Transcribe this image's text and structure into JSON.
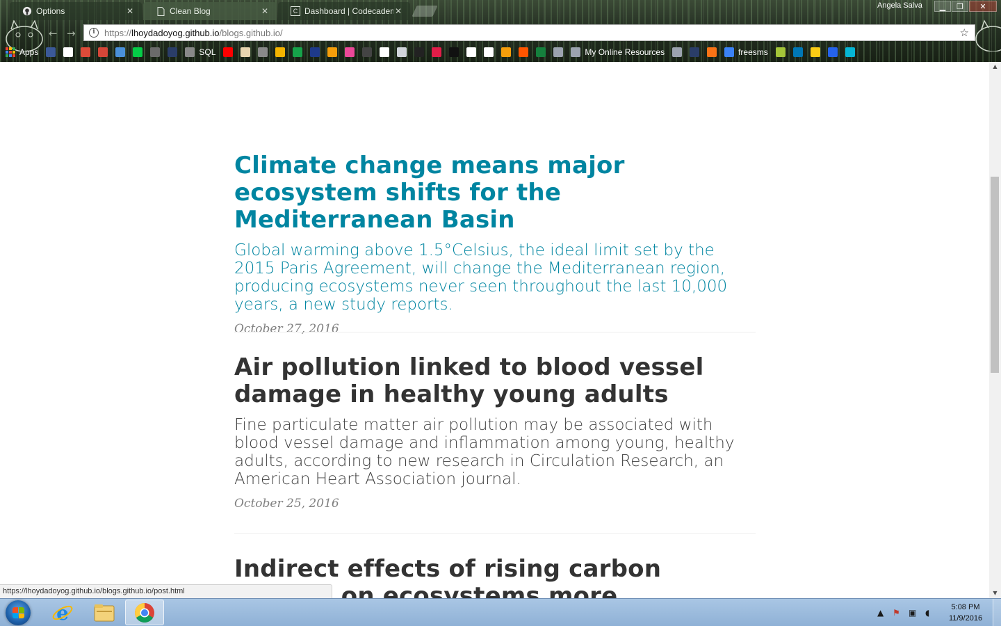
{
  "browser": {
    "tabs": [
      {
        "label": "Options",
        "icon": "github-icon",
        "active": false
      },
      {
        "label": "Clean Blog",
        "icon": "page-icon",
        "active": true
      },
      {
        "label": "Dashboard | Codecadem",
        "icon": "codecademy-icon",
        "active": false
      }
    ],
    "user": "Angela Salva",
    "address": {
      "scheme": "https://",
      "host": "lhoydadoyog.github.io",
      "path": "/blogs.github.io/"
    },
    "bookmarks": [
      {
        "label": "Apps",
        "icon": "apps-grid-icon"
      },
      {
        "label": "",
        "icon": "facebook-icon",
        "color": "#3b5998"
      },
      {
        "label": "",
        "icon": "google-icon",
        "color": "#ffffff"
      },
      {
        "label": "",
        "icon": "google-plus-icon",
        "color": "#dd4b39"
      },
      {
        "label": "",
        "icon": "gmail-icon",
        "color": "#d44638"
      },
      {
        "label": "",
        "icon": "shield-icon",
        "color": "#4a90d9"
      },
      {
        "label": "",
        "icon": "deviantart-icon",
        "color": "#05cc47"
      },
      {
        "label": "",
        "icon": "page-icon",
        "color": "#6b6b6b"
      },
      {
        "label": "",
        "icon": "bookmark-icon",
        "color": "#2a3d68"
      },
      {
        "label": "SQL",
        "icon": "sql-icon"
      },
      {
        "label": "",
        "icon": "youtube-icon",
        "color": "#ff0000"
      },
      {
        "label": "",
        "icon": "owl-icon",
        "color": "#e8d5b0"
      },
      {
        "label": "",
        "icon": "grid-icon",
        "color": "#8a8a8a"
      },
      {
        "label": "",
        "icon": "palette-icon",
        "color": "#f4b400"
      },
      {
        "label": "",
        "icon": "tv-icon",
        "color": "#16a34a"
      },
      {
        "label": "",
        "icon": "star-circle-icon",
        "color": "#1e3a8a"
      },
      {
        "label": "",
        "icon": "film-icon",
        "color": "#f59e0b"
      },
      {
        "label": "",
        "icon": "k-icon",
        "color": "#ec4899"
      },
      {
        "label": "",
        "icon": "cube-icon",
        "color": "#444444"
      },
      {
        "label": "",
        "icon": "reddit-icon",
        "color": "#ffffff"
      },
      {
        "label": "",
        "icon": "fork-icon",
        "color": "#d1d5db"
      },
      {
        "label": "",
        "icon": "alien-icon",
        "color": "#222222"
      },
      {
        "label": "",
        "icon": "m-icon",
        "color": "#e11d48"
      },
      {
        "label": "",
        "icon": "bug-icon",
        "color": "#111111"
      },
      {
        "label": "",
        "icon": "a-icon",
        "color": "#ffffff"
      },
      {
        "label": "",
        "icon": "spiral-icon",
        "color": "#ffffff"
      },
      {
        "label": "",
        "icon": "w-icon",
        "color": "#f59e0b"
      },
      {
        "label": "",
        "icon": "soundcloud-icon",
        "color": "#ff5500"
      },
      {
        "label": "",
        "icon": "book-icon",
        "color": "#15803d"
      },
      {
        "label": "",
        "icon": "robot-icon",
        "color": "#9ca3af"
      },
      {
        "label": "My Online Resources",
        "icon": "robot-icon",
        "color": "#9ca3af"
      },
      {
        "label": "",
        "icon": "robot-icon",
        "color": "#9ca3af"
      },
      {
        "label": "",
        "icon": "bookmark-icon",
        "color": "#2a3d68"
      },
      {
        "label": "",
        "icon": "orange-box-icon",
        "color": "#f97316"
      },
      {
        "label": "freesms",
        "icon": "phone-icon",
        "color": "#3b82f6"
      },
      {
        "label": "",
        "icon": "android-icon",
        "color": "#a4c639"
      },
      {
        "label": "",
        "icon": "linkedin-icon",
        "color": "#0077b5"
      },
      {
        "label": "",
        "icon": "question-box-icon",
        "color": "#facc15"
      },
      {
        "label": "",
        "icon": "target-icon",
        "color": "#2563eb"
      },
      {
        "label": "",
        "icon": "u-icon",
        "color": "#06b6d4"
      }
    ],
    "status_url": "https://lhoydadoyog.github.io/blogs.github.io/post.html"
  },
  "posts": [
    {
      "title": "Climate change means major ecosystem shifts for the Mediterranean Basin",
      "subtitle": "Global warming above 1.5°Celsius, the ideal limit set by the 2015 Paris Agreement, will change the Mediterranean region, producing ecosystems never seen throughout the last 10,000 years, a new study reports.",
      "date": "October 27, 2016",
      "hovered": true
    },
    {
      "title": "Air pollution linked to blood vessel damage in healthy young adults",
      "subtitle": "Fine particulate matter air pollution may be associated with blood vessel damage and inflammation among young, healthy adults, according to new research in Circulation Research, an American Heart Association journal.",
      "date": "October 25, 2016",
      "hovered": false
    },
    {
      "title": "Indirect effects of rising carbon dioxide on ecosystems more important",
      "subtitle": "",
      "date": "",
      "hovered": false
    }
  ],
  "taskbar": {
    "clock_time": "5:08 PM",
    "clock_date": "11/9/2016",
    "apps": [
      "internet-explorer-icon",
      "file-explorer-icon",
      "chrome-icon"
    ]
  },
  "colors": {
    "link_hover": "#0085a1",
    "heading": "#333333",
    "subheading": "#404040",
    "meta": "#808080"
  }
}
